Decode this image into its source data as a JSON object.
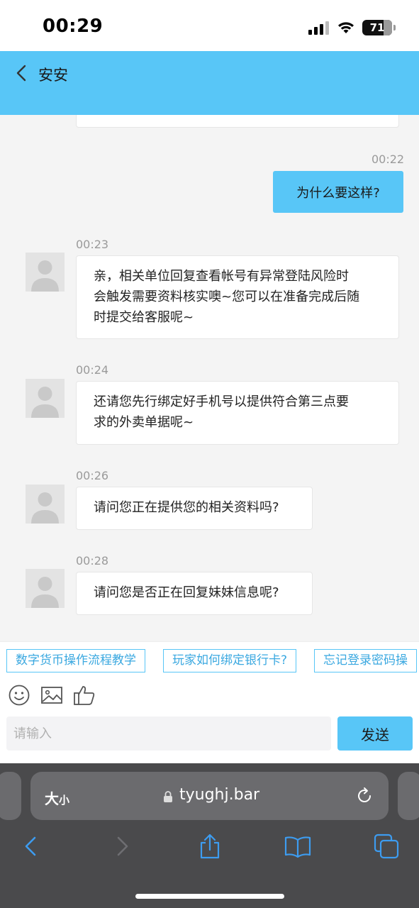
{
  "status_bar": {
    "time": "00:29",
    "battery": "71",
    "battery_level": 0.71
  },
  "header": {
    "title": "安安"
  },
  "messages": [
    {
      "from": "me",
      "time": "00:22",
      "text": "为什么要这样?"
    },
    {
      "from": "agent",
      "time": "00:23",
      "lines": [
        "亲，相关单位回复查看帐号有异常登陆风险时",
        "会触发需要资料核实噢~您可以在准备完成后随",
        "时提交给客服呢~"
      ]
    },
    {
      "from": "agent",
      "time": "00:24",
      "lines": [
        "还请您先行绑定好手机号以提供符合第三点要",
        "求的外卖单据呢~"
      ]
    },
    {
      "from": "agent",
      "time": "00:26",
      "lines": [
        "请问您正在提供您的相关资料吗?"
      ]
    },
    {
      "from": "agent",
      "time": "00:28",
      "lines": [
        "请问您是否正在回复妹妹信息呢?"
      ]
    }
  ],
  "quick_replies": [
    "数字货币操作流程教学",
    "玩家如何绑定银行卡?",
    "忘记登录密码操"
  ],
  "input": {
    "placeholder": "请输入",
    "value": ""
  },
  "send_label": "发送",
  "browser": {
    "text_size_big": "大",
    "text_size_small": "小",
    "url": "tyughj.bar"
  },
  "colors": {
    "accent": "#58c6f7",
    "chip_text": "#3aa8e0",
    "browser_bg": "#4a4a4c"
  },
  "icons": [
    "back-chevron-icon",
    "signal-icon",
    "wifi-icon",
    "battery-icon",
    "avatar-placeholder-icon",
    "emoji-icon",
    "image-icon",
    "thumbs-up-icon",
    "lock-icon",
    "reload-icon",
    "safari-back-icon",
    "safari-forward-icon",
    "share-icon",
    "bookmarks-icon",
    "tabs-icon"
  ]
}
